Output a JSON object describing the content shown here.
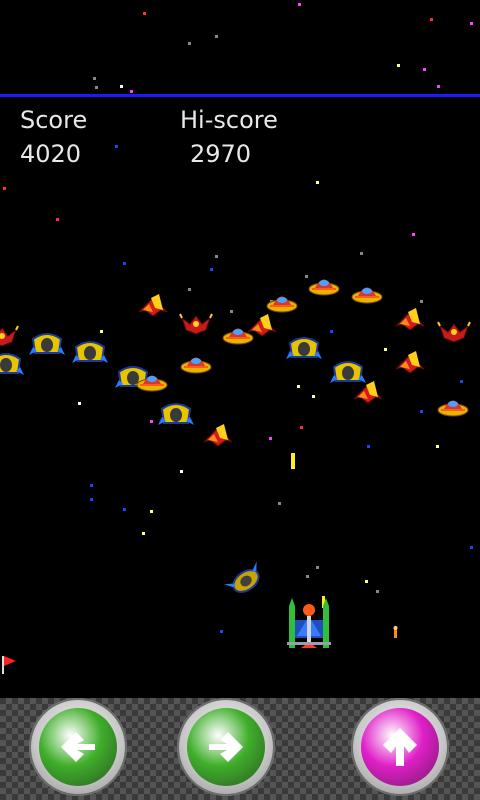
{
  "hud": {
    "score_label": "Score",
    "score_value": "4020",
    "hiscore_label": "Hi-score",
    "hiscore_value": "2970"
  },
  "colors": {
    "background": "#000000",
    "hud_divider": "#1a1aff",
    "hud_text": "#e8e8e8",
    "left_button": "#3fae2a",
    "right_button": "#3fae2a",
    "fire_button": "#e01fc8"
  },
  "controls": {
    "left_button_icon": "arrow-left-icon",
    "right_button_icon": "arrow-right-icon",
    "fire_button_icon": "arrow-up-icon"
  },
  "game": {
    "enemy_types": [
      "red-winged-fighter",
      "yellow-beetle-ship",
      "saucer-ship",
      "red-crab-ship"
    ],
    "player_ship": "green-twin-cannon-ship",
    "stage_marker": "red-flag-icon"
  }
}
